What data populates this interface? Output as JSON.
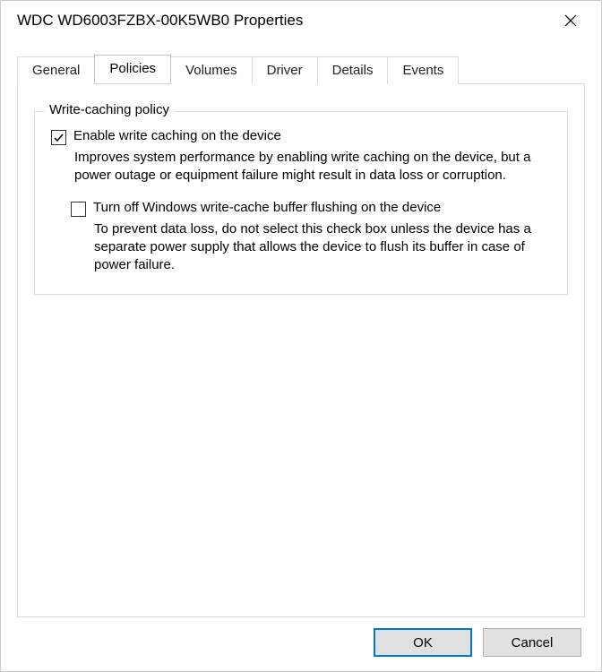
{
  "window": {
    "title": "WDC WD6003FZBX-00K5WB0 Properties"
  },
  "tabs": [
    {
      "label": "General",
      "active": false
    },
    {
      "label": "Policies",
      "active": true
    },
    {
      "label": "Volumes",
      "active": false
    },
    {
      "label": "Driver",
      "active": false
    },
    {
      "label": "Details",
      "active": false
    },
    {
      "label": "Events",
      "active": false
    }
  ],
  "policies": {
    "group_title": "Write-caching policy",
    "enable": {
      "label": "Enable write caching on the device",
      "checked": true,
      "desc": "Improves system performance by enabling write caching on the device, but a power outage or equipment failure might result in data loss or corruption."
    },
    "flush_off": {
      "label": "Turn off Windows write-cache buffer flushing on the device",
      "checked": false,
      "desc": "To prevent data loss, do not select this check box unless the device has a separate power supply that allows the device to flush its buffer in case of power failure."
    }
  },
  "buttons": {
    "ok": "OK",
    "cancel": "Cancel"
  }
}
